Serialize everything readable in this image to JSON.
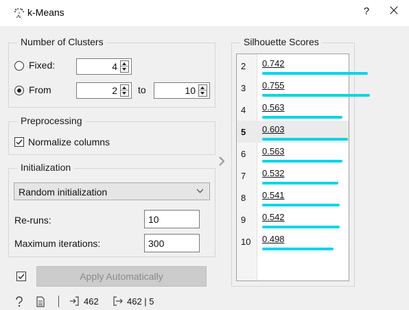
{
  "window": {
    "title": "k-Means",
    "help_label": "?",
    "close_label": "×"
  },
  "clusters": {
    "title": "Number of Clusters",
    "fixed_label": "Fixed:",
    "fixed_value": "4",
    "from_label": "From",
    "from_value": "2",
    "to_label": "to",
    "to_value": "10",
    "selected_mode": "From"
  },
  "preprocessing": {
    "title": "Preprocessing",
    "normalize_label": "Normalize columns",
    "normalize_checked": true
  },
  "initialization": {
    "title": "Initialization",
    "method": "Random initialization",
    "reruns_label": "Re-runs:",
    "reruns_value": "10",
    "maxiter_label": "Maximum iterations:",
    "maxiter_value": "300"
  },
  "apply": {
    "auto_checked": true,
    "label": "Apply Automatically"
  },
  "silhouette": {
    "title": "Silhouette Scores",
    "selected_k": "5",
    "rows": [
      {
        "k": "2",
        "score": "0.742",
        "bar": 0.742
      },
      {
        "k": "3",
        "score": "0.755",
        "bar": 0.755
      },
      {
        "k": "4",
        "score": "0.563",
        "bar": 0.563
      },
      {
        "k": "5",
        "score": "0.603",
        "bar": 0.603
      },
      {
        "k": "6",
        "score": "0.563",
        "bar": 0.563
      },
      {
        "k": "7",
        "score": "0.532",
        "bar": 0.532
      },
      {
        "k": "8",
        "score": "0.541",
        "bar": 0.541
      },
      {
        "k": "9",
        "score": "0.542",
        "bar": 0.542
      },
      {
        "k": "10",
        "score": "0.498",
        "bar": 0.498
      }
    ],
    "bar_color": "#00d6e8"
  },
  "status": {
    "input_count": "462",
    "output_count": "462 | 5"
  }
}
